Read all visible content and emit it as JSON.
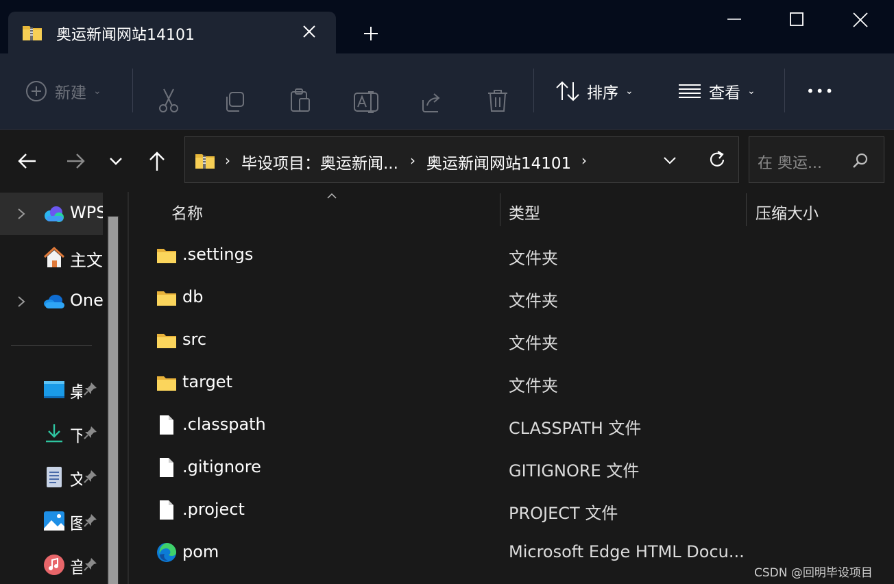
{
  "window": {
    "tab_title": "奥运新闻网站14101",
    "tab_close_symbol": "✕",
    "new_tab_symbol": "+"
  },
  "toolbar": {
    "new_label": "新建",
    "sort_label": "排序",
    "view_label": "查看",
    "more_label": "•••"
  },
  "address": {
    "crumbs": [
      "毕设项目：奥运新闻...",
      "奥运新闻网站14101"
    ],
    "search_placeholder": "在 奥运..."
  },
  "sidebar": {
    "items": [
      {
        "label": "WPS",
        "icon": "wps-cloud-icon"
      },
      {
        "label": "主文",
        "icon": "home-icon"
      },
      {
        "label": "One",
        "icon": "onedrive-icon"
      },
      {
        "label": "桌",
        "icon": "desktop-icon"
      },
      {
        "label": "下",
        "icon": "downloads-icon"
      },
      {
        "label": "文",
        "icon": "documents-icon"
      },
      {
        "label": "图",
        "icon": "pictures-icon"
      },
      {
        "label": "音",
        "icon": "music-icon"
      }
    ]
  },
  "columns": {
    "name": "名称",
    "type": "类型",
    "size": "压缩大小"
  },
  "files": [
    {
      "name": ".settings",
      "type": "文件夹",
      "icon": "folder-icon"
    },
    {
      "name": "db",
      "type": "文件夹",
      "icon": "folder-icon"
    },
    {
      "name": "src",
      "type": "文件夹",
      "icon": "folder-icon"
    },
    {
      "name": "target",
      "type": "文件夹",
      "icon": "folder-icon"
    },
    {
      "name": ".classpath",
      "type": "CLASSPATH 文件",
      "icon": "file-icon"
    },
    {
      "name": ".gitignore",
      "type": "GITIGNORE 文件",
      "icon": "file-icon"
    },
    {
      "name": ".project",
      "type": "PROJECT 文件",
      "icon": "file-icon"
    },
    {
      "name": "pom",
      "type": "Microsoft Edge HTML Docu...",
      "icon": "edge-icon"
    }
  ],
  "watermark": "CSDN @回明毕设项目",
  "colors": {
    "titlebar": "#050c1b",
    "toolbar": "#1d2432",
    "content": "#191919",
    "folder": "#f5c542"
  }
}
